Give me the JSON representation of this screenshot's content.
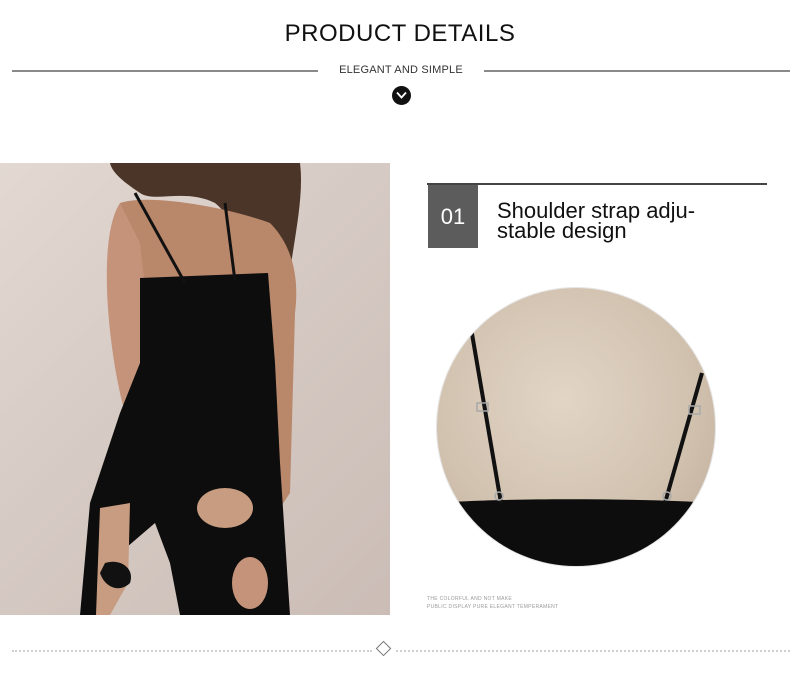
{
  "header": {
    "title": "PRODUCT DETAILS",
    "subtitle": "ELEGANT AND SIMPLE"
  },
  "feature": {
    "number": "01",
    "text_line1": "Shoulder strap adju-",
    "text_line2": "stable design"
  },
  "fine_print": {
    "line1": "THE COLORFUL AND NOT MAKE",
    "line2": "PUBLIC DISPLAY PURE ELEGANT TEMPERAMENT"
  },
  "icons": {
    "header_badge": "chevron-down-icon",
    "footer_divider": "diamond-icon"
  },
  "colors": {
    "text": "#111111",
    "number_box": "#5c5c5c",
    "rule": "#8a8a8a",
    "dress": "#0d0d0d"
  }
}
